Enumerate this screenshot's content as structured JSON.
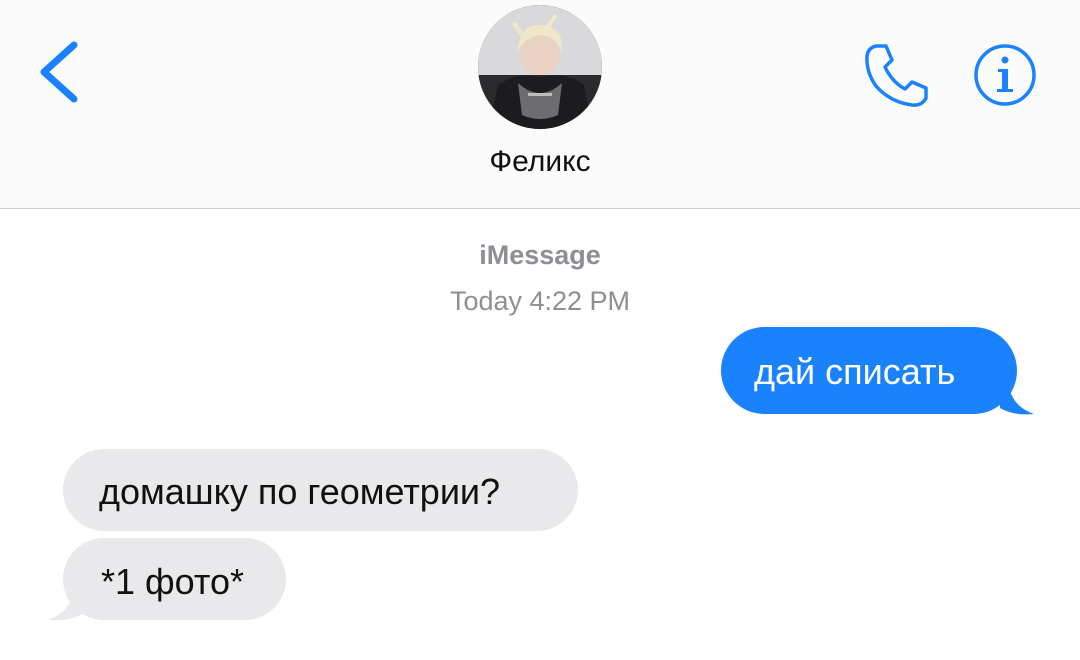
{
  "header": {
    "contact_name": "Феликс",
    "back_icon": "chevron-left-icon",
    "call_icon": "phone-icon",
    "info_icon": "info-icon",
    "accent_color": "#1982fc"
  },
  "meta": {
    "service": "iMessage",
    "timestamp": "Today 4:22 PM"
  },
  "messages": [
    {
      "direction": "outgoing",
      "text": "дай списать",
      "color": "#1982fc"
    },
    {
      "direction": "incoming",
      "text": "домашку по геометрии?",
      "color": "#e9e9eb"
    },
    {
      "direction": "incoming",
      "text": "*1 фото*",
      "color": "#e9e9eb"
    }
  ]
}
